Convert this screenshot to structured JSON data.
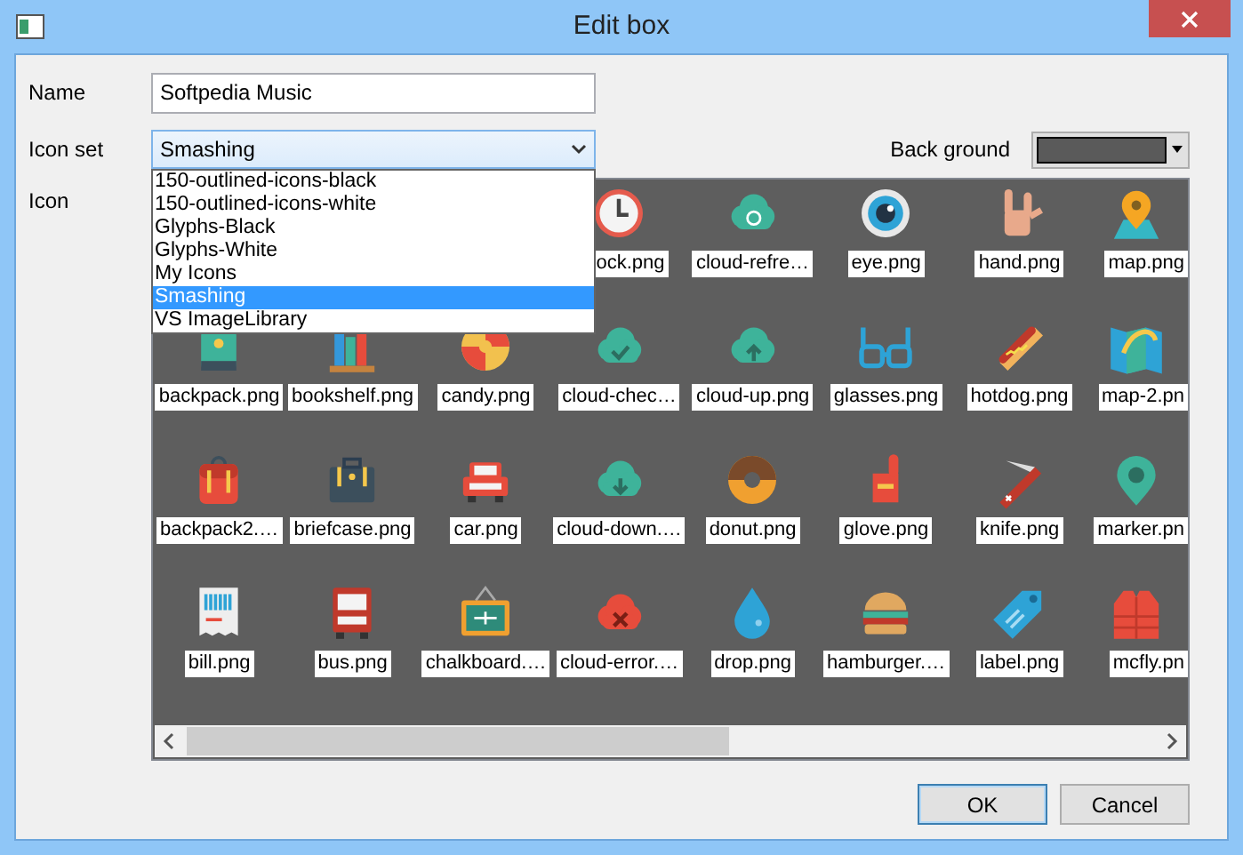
{
  "window": {
    "title": "Edit box"
  },
  "name_field": {
    "label": "Name",
    "value": "Softpedia Music"
  },
  "icon_set": {
    "label": "Icon set",
    "value": "Smashing",
    "expanded": true,
    "options": [
      {
        "label": "150-outlined-icons-black",
        "selected": false
      },
      {
        "label": "150-outlined-icons-white",
        "selected": false
      },
      {
        "label": "Glyphs-Black",
        "selected": false
      },
      {
        "label": "Glyphs-White",
        "selected": false
      },
      {
        "label": "My Icons",
        "selected": false
      },
      {
        "label": "Smashing",
        "selected": true
      },
      {
        "label": "VS ImageLibrary",
        "selected": false
      }
    ]
  },
  "background": {
    "label": "Back ground",
    "color": "#5a5a5a"
  },
  "icon_grid": {
    "label": "Icon",
    "rows": [
      [
        "",
        "",
        "",
        "ock.png",
        "cloud-refre…",
        "eye.png",
        "hand.png",
        "map.png"
      ],
      [
        "backpack.png",
        "bookshelf.png",
        "candy.png",
        "cloud-chec…",
        "cloud-up.png",
        "glasses.png",
        "hotdog.png",
        "map-2.pn"
      ],
      [
        "backpack2.…",
        "briefcase.png",
        "car.png",
        "cloud-down.…",
        "donut.png",
        "glove.png",
        "knife.png",
        "marker.pn"
      ],
      [
        "bill.png",
        "bus.png",
        "chalkboard.…",
        "cloud-error.…",
        "drop.png",
        "hamburger.…",
        "label.png",
        "mcfly.pn"
      ]
    ]
  },
  "buttons": [
    {
      "label": "OK",
      "default": true
    },
    {
      "label": "Cancel",
      "default": false
    }
  ]
}
